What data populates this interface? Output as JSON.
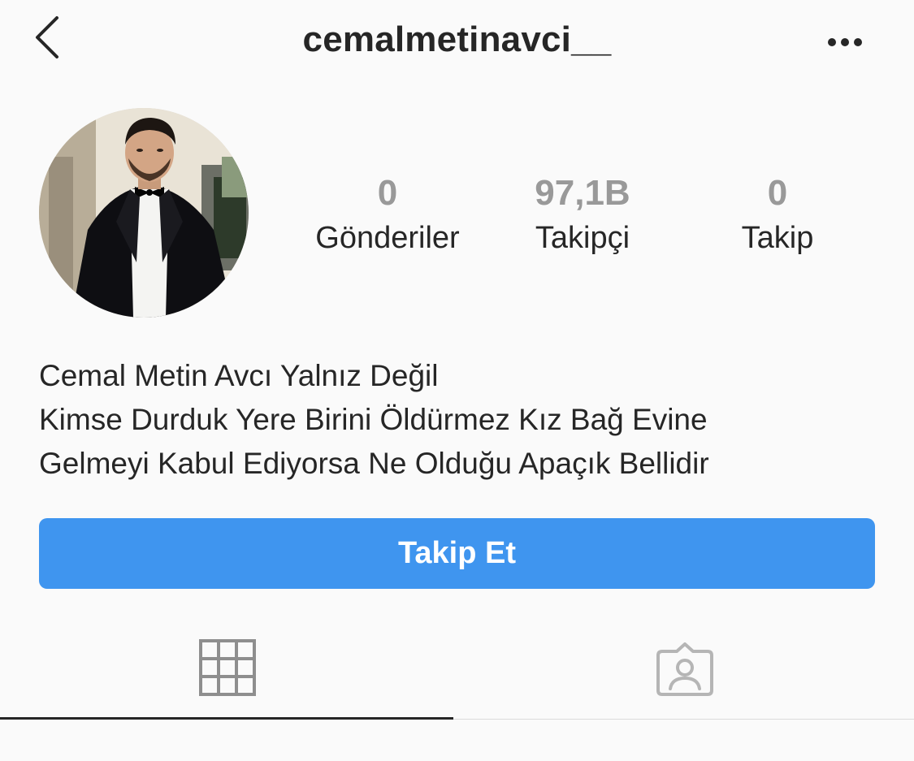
{
  "header": {
    "title": "cemalmetinavci__",
    "back_icon": "chevron-left-icon",
    "more_icon": "more-horizontal-icon"
  },
  "profile": {
    "avatar": "profile-photo"
  },
  "stats": [
    {
      "value": "0",
      "label": "Gönderiler"
    },
    {
      "value": "97,1B",
      "label": "Takipçi"
    },
    {
      "value": "0",
      "label": "Takip"
    }
  ],
  "bio": {
    "lines": [
      "Cemal Metin Avcı Yalnız Değil",
      "Kimse Durduk Yere Birini Öldürmez Kız Bağ Evine",
      "Gelmeyi Kabul Ediyorsa Ne Olduğu Apaçık Bellidir"
    ]
  },
  "follow_button": {
    "label": "Takip Et"
  },
  "tabs": [
    {
      "icon": "grid-icon",
      "active": true
    },
    {
      "icon": "tagged-user-icon",
      "active": false
    }
  ],
  "colors": {
    "accent": "#3f95ef",
    "text": "#262626",
    "muted": "#999999",
    "background": "#fafafa"
  }
}
